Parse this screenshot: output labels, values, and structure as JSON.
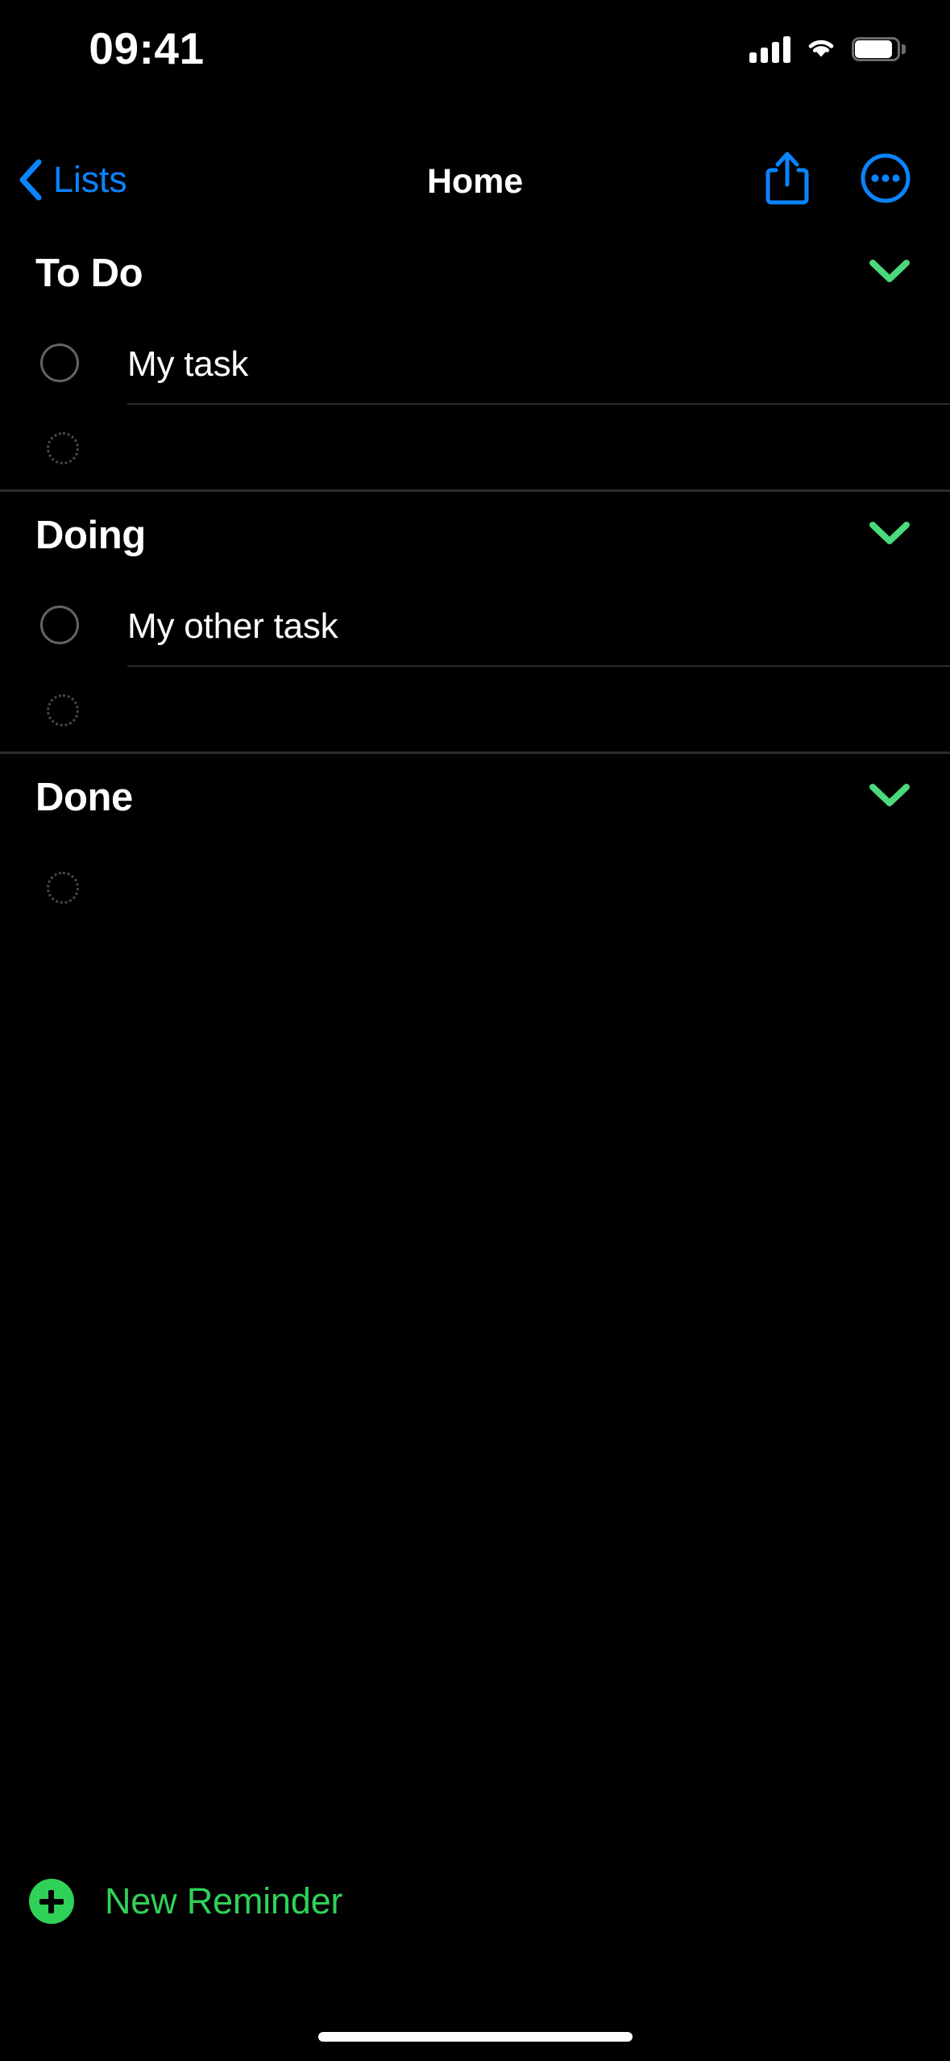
{
  "status_bar": {
    "time": "09:41",
    "cellular_icon": "cellular-signal-icon",
    "wifi_icon": "wifi-icon",
    "battery_icon": "battery-icon"
  },
  "nav": {
    "back_label": "Lists",
    "back_icon": "chevron-left-icon",
    "title": "Home",
    "share_icon": "share-icon",
    "more_icon": "ellipsis-circle-icon"
  },
  "colors": {
    "accent_blue": "#0A84FF",
    "accent_green": "#30D158",
    "chevron_green": "#4CD97B",
    "background": "#000000",
    "separator": "#2c2c2e",
    "circle_outline": "#636366"
  },
  "sections": [
    {
      "title": "To Do",
      "collapse_icon": "chevron-down-icon",
      "items": [
        {
          "text": "My task",
          "checkbox_icon": "circle-outline-icon",
          "completed": false
        }
      ],
      "new_item_placeholder": "",
      "new_item_icon": "dotted-circle-icon"
    },
    {
      "title": "Doing",
      "collapse_icon": "chevron-down-icon",
      "items": [
        {
          "text": "My other task",
          "checkbox_icon": "circle-outline-icon",
          "completed": false
        }
      ],
      "new_item_placeholder": "",
      "new_item_icon": "dotted-circle-icon"
    },
    {
      "title": "Done",
      "collapse_icon": "chevron-down-icon",
      "items": [],
      "new_item_placeholder": "",
      "new_item_icon": "dotted-circle-icon"
    }
  ],
  "footer": {
    "new_reminder_label": "New Reminder",
    "new_reminder_icon": "plus-circle-icon"
  }
}
